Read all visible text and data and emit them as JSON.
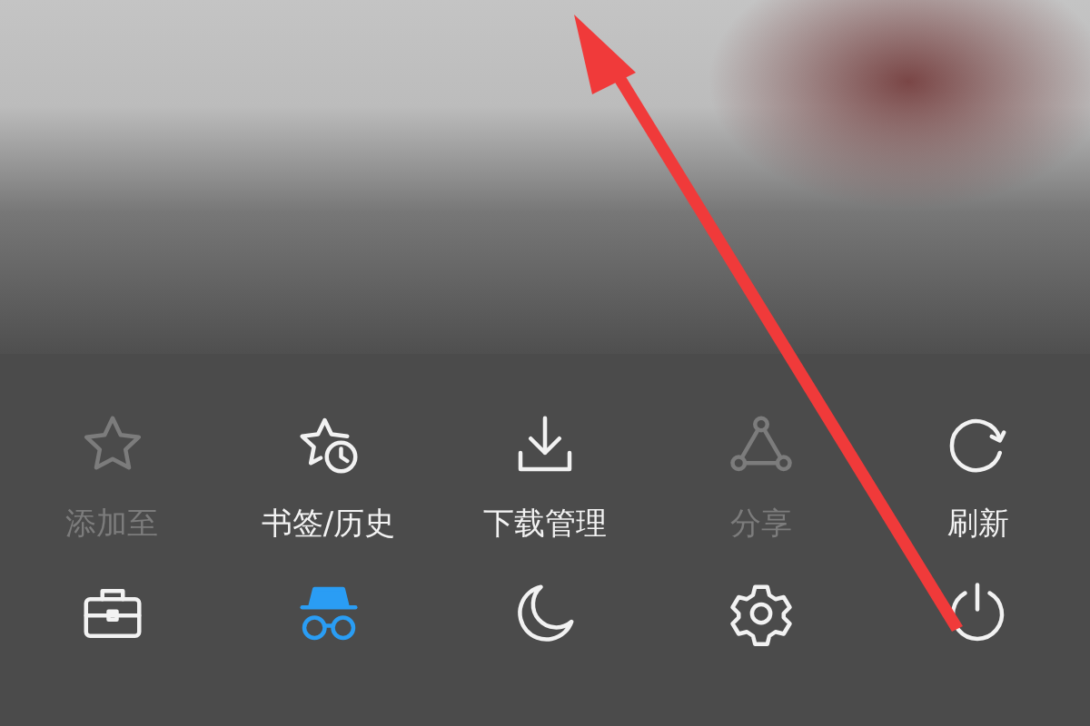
{
  "menu": {
    "rows": [
      {
        "items": [
          {
            "kind": "star",
            "label": "添加至",
            "disabled": true,
            "active": false
          },
          {
            "kind": "bookmark-history",
            "label": "书签/历史",
            "disabled": false,
            "active": false
          },
          {
            "kind": "download",
            "label": "下载管理",
            "disabled": false,
            "active": false
          },
          {
            "kind": "share",
            "label": "分享",
            "disabled": true,
            "active": false
          },
          {
            "kind": "refresh",
            "label": "刷新",
            "disabled": false,
            "active": false
          }
        ]
      },
      {
        "items": [
          {
            "kind": "toolbox",
            "disabled": false,
            "active": false
          },
          {
            "kind": "incognito",
            "disabled": false,
            "active": true
          },
          {
            "kind": "moon",
            "disabled": false,
            "active": false
          },
          {
            "kind": "gear",
            "disabled": false,
            "active": false
          },
          {
            "kind": "power",
            "disabled": false,
            "active": false
          }
        ]
      }
    ]
  }
}
